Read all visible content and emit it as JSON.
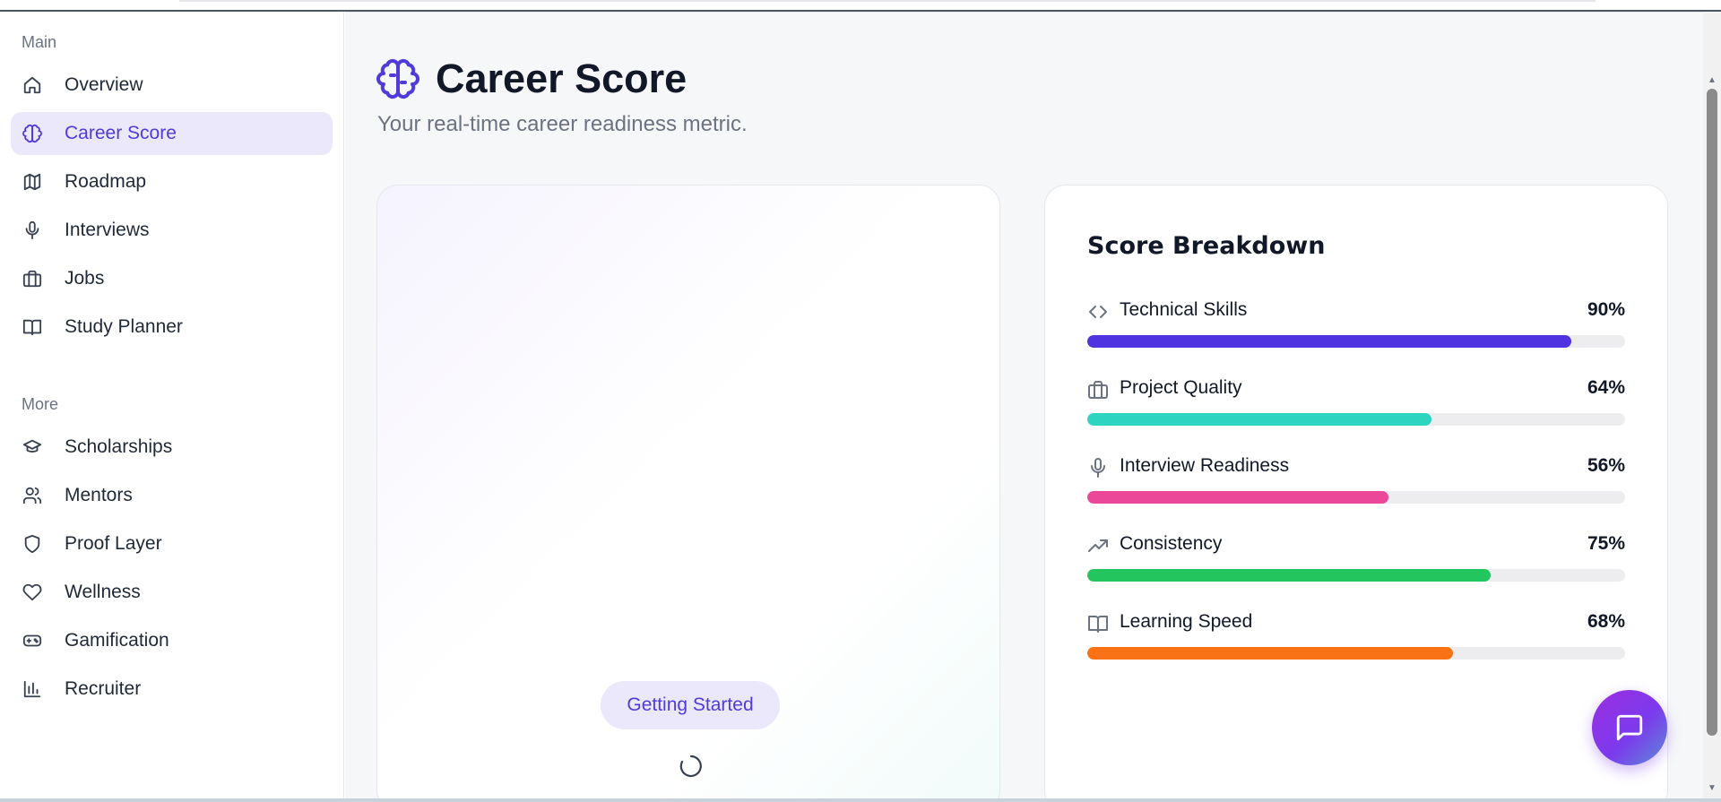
{
  "sidebar": {
    "main_label": "Main",
    "more_label": "More",
    "main_items": [
      {
        "label": "Overview",
        "icon": "home-icon",
        "active": false
      },
      {
        "label": "Career Score",
        "icon": "brain-icon",
        "active": true
      },
      {
        "label": "Roadmap",
        "icon": "map-icon",
        "active": false
      },
      {
        "label": "Interviews",
        "icon": "microphone-icon",
        "active": false
      },
      {
        "label": "Jobs",
        "icon": "briefcase-icon",
        "active": false
      },
      {
        "label": "Study Planner",
        "icon": "book-icon",
        "active": false
      }
    ],
    "more_items": [
      {
        "label": "Scholarships",
        "icon": "graduation-cap-icon"
      },
      {
        "label": "Mentors",
        "icon": "users-icon"
      },
      {
        "label": "Proof Layer",
        "icon": "shield-icon"
      },
      {
        "label": "Wellness",
        "icon": "heart-icon"
      },
      {
        "label": "Gamification",
        "icon": "gamepad-icon"
      },
      {
        "label": "Recruiter",
        "icon": "bar-chart-icon"
      }
    ]
  },
  "page": {
    "title": "Career Score",
    "subtitle": "Your real-time career readiness metric."
  },
  "score_card": {
    "badge": "Getting Started"
  },
  "breakdown": {
    "title": "Score Breakdown",
    "metrics": [
      {
        "name": "Technical Skills",
        "value_label": "90%",
        "value": 90,
        "color": "#4f33e0",
        "icon": "code-icon"
      },
      {
        "name": "Project Quality",
        "value_label": "64%",
        "value": 64,
        "color": "#2dd4bf",
        "icon": "briefcase-icon"
      },
      {
        "name": "Interview Readiness",
        "value_label": "56%",
        "value": 56,
        "color": "#ec4899",
        "icon": "microphone-icon"
      },
      {
        "name": "Consistency",
        "value_label": "75%",
        "value": 75,
        "color": "#22c55e",
        "icon": "trending-up-icon"
      },
      {
        "name": "Learning Speed",
        "value_label": "68%",
        "value": 68,
        "color": "#f97316",
        "icon": "book-icon"
      }
    ]
  },
  "colors": {
    "accent": "#4f3bd9",
    "active_bg": "#ebe8fb"
  }
}
